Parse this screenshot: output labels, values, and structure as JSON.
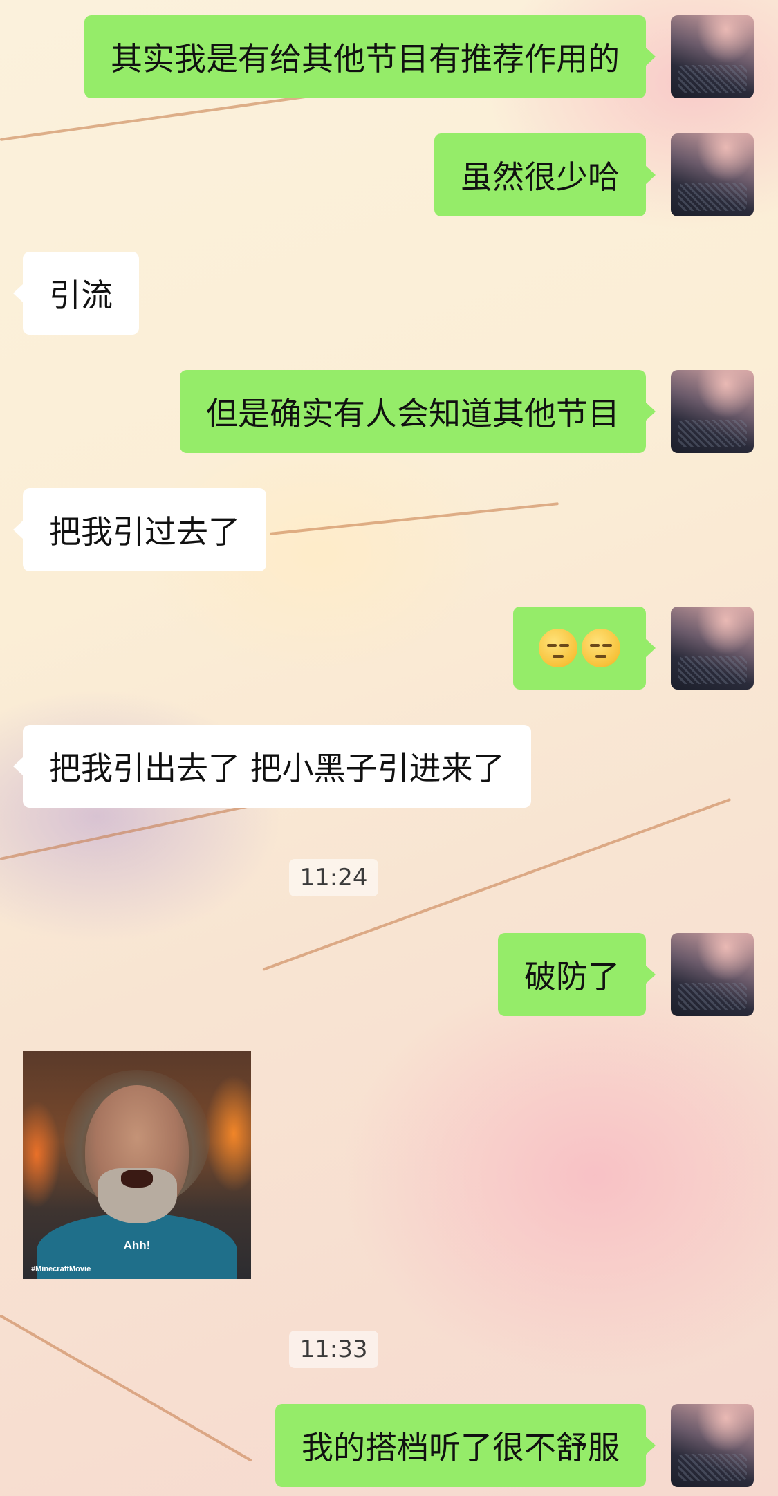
{
  "chat": {
    "messages": [
      {
        "side": "out",
        "text": "其实我是有给其他节目有推荐作用的"
      },
      {
        "side": "out",
        "text": "虽然很少哈"
      },
      {
        "side": "in",
        "text": "引流"
      },
      {
        "side": "out",
        "text": "但是确实有人会知道其他节目"
      },
      {
        "side": "in",
        "text": "把我引过去了"
      },
      {
        "side": "out",
        "emoji": [
          "unamused-face-icon",
          "unamused-face-icon"
        ]
      },
      {
        "side": "in",
        "text": "把我引出去了 把小黑子引进来了"
      },
      {
        "timestamp": "11:24"
      },
      {
        "side": "out",
        "text": "破防了"
      },
      {
        "side": "in",
        "sticker": {
          "caption": "Ahh!",
          "tag": "#MinecraftMovie"
        }
      },
      {
        "timestamp": "11:33"
      },
      {
        "side": "out",
        "text": "我的搭档听了很不舒服"
      }
    ]
  },
  "colors": {
    "outgoing_bubble": "#95ec69",
    "incoming_bubble": "#ffffff"
  }
}
